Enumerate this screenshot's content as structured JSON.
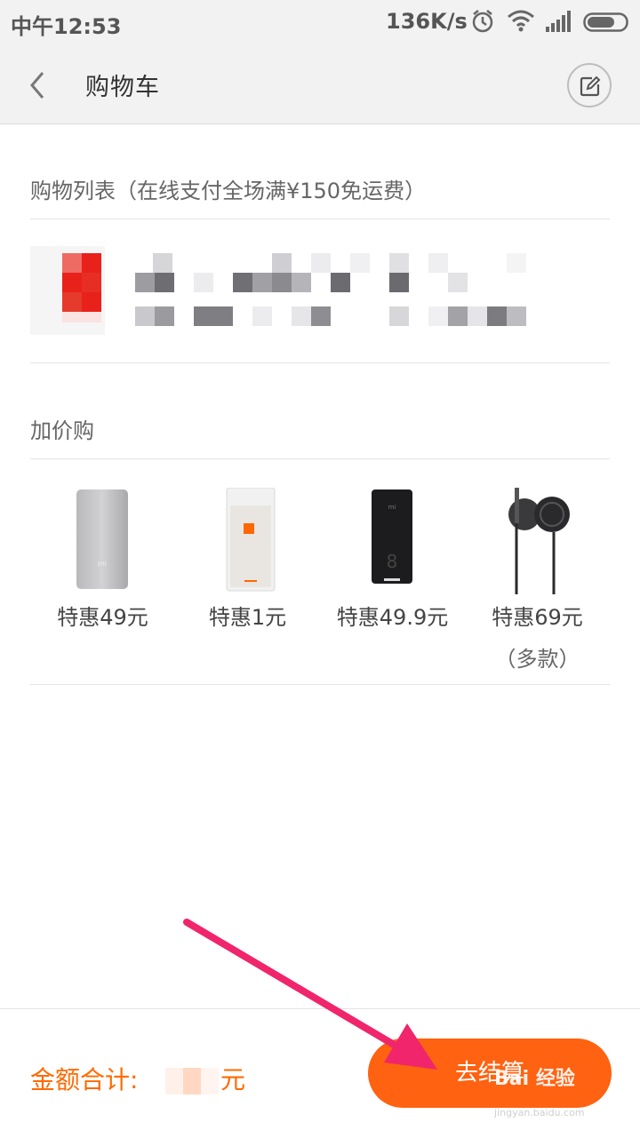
{
  "status_bar": {
    "time": "中午12:53",
    "speed": "136K/s",
    "icons": [
      "alarm-icon",
      "wifi-icon",
      "signal-icon",
      "battery-icon"
    ]
  },
  "header": {
    "title": "购物车",
    "back_icon": "chevron-left-icon",
    "edit_icon": "edit-icon"
  },
  "cart": {
    "section_title": "购物列表（在线支付全场满¥150免运费）",
    "item_blurred": true
  },
  "addons": {
    "section_title": "加价购",
    "items": [
      {
        "price": "特惠49元",
        "note": "",
        "icon": "power-bank-image"
      },
      {
        "price": "特惠1元",
        "note": "",
        "icon": "packaged-accessory-image"
      },
      {
        "price": "特惠49.9元",
        "note": "",
        "icon": "router-image"
      },
      {
        "price": "特惠69元",
        "note": "（多款）",
        "icon": "earphones-image"
      }
    ]
  },
  "footer": {
    "total_label": "金额合计:",
    "total_unit": "元",
    "checkout_label": "去结算"
  },
  "watermark": {
    "brand": "Bai 经验",
    "url": "jingyan.baidu.com"
  },
  "colors": {
    "accent": "#ff6210",
    "total_text": "#ff6a00",
    "arrow": "#f0256b",
    "background": "#ffffff",
    "header_bg": "#f2f2f2"
  }
}
